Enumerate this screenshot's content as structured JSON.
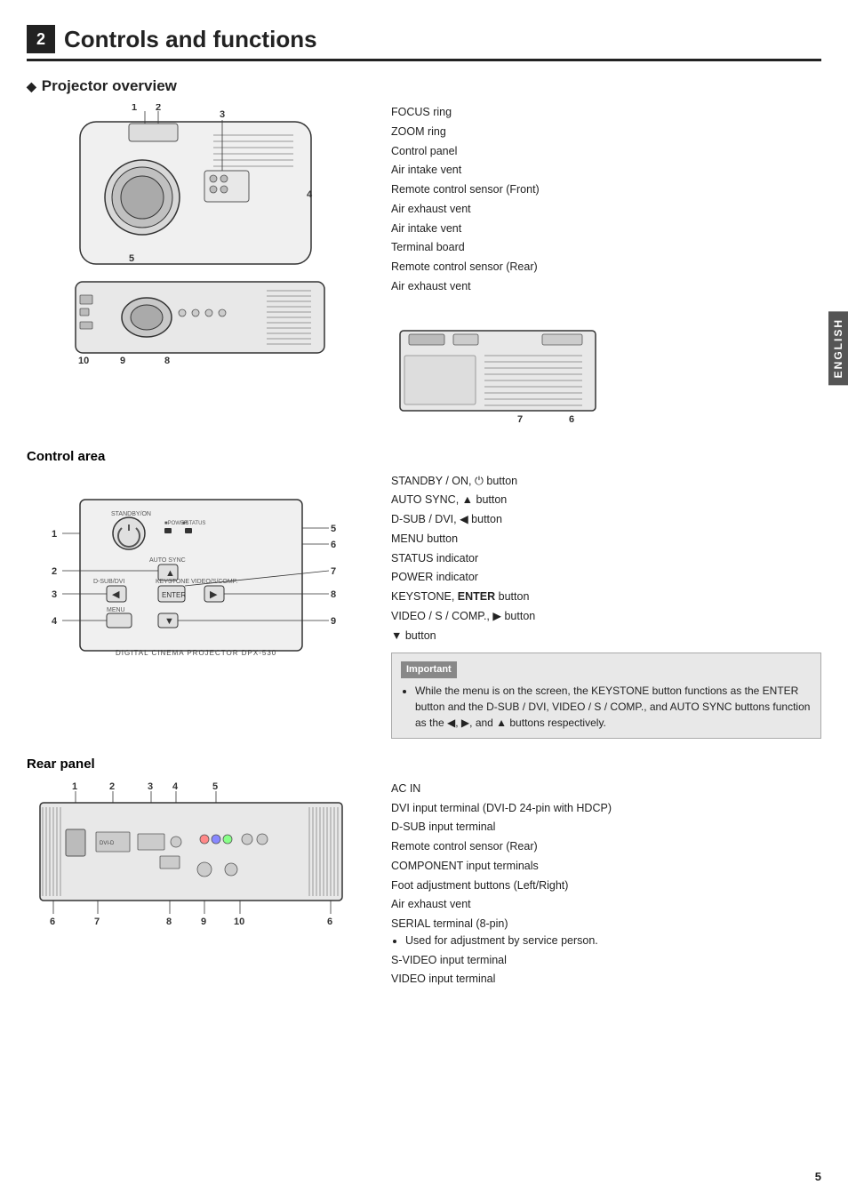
{
  "header": {
    "chapter": "2",
    "title": "Controls and functions"
  },
  "projector_overview": {
    "section_title": "Projector overview",
    "items": [
      "FOCUS ring",
      "ZOOM ring",
      "Control panel",
      "Air intake vent",
      "Remote control sensor (Front)",
      "Air exhaust vent",
      "Air intake vent",
      "Terminal board",
      "Remote control sensor (Rear)",
      "Air exhaust vent"
    ]
  },
  "control_area": {
    "section_title": "Control area",
    "items": [
      {
        "num": "1.",
        "text": "STANDBY / ON, "
      },
      {
        "num": "2.",
        "text": "AUTO SYNC, ▲ button"
      },
      {
        "num": "3.",
        "text": "D-SUB / DVI, ◀ button"
      },
      {
        "num": "4.",
        "text": "MENU button"
      },
      {
        "num": "5.",
        "text": "STATUS indicator"
      },
      {
        "num": "6.",
        "text": "POWER indicator"
      },
      {
        "num": "7.",
        "text": "KEYSTONE, ENTER button",
        "bold_part": "ENTER"
      },
      {
        "num": "8.",
        "text": "VIDEO / S / COMP., ▶ button"
      },
      {
        "num": "9.",
        "text": "▼ button"
      }
    ],
    "important_label": "Important",
    "important_text": "While the menu is on the screen, the KEYSTONE button functions as the ENTER button and the D-SUB / DVI, VIDEO / S / COMP., and AUTO SYNC buttons function as the ◀, ▶, and ▲ buttons respectively."
  },
  "rear_panel": {
    "section_title": "Rear panel",
    "items": [
      {
        "num": "1.",
        "text": "AC IN"
      },
      {
        "num": "2.",
        "text": "DVI input terminal (DVI-D 24-pin with HDCP)"
      },
      {
        "num": "3.",
        "text": "D-SUB input terminal"
      },
      {
        "num": "4.",
        "text": "Remote control sensor (Rear)"
      },
      {
        "num": "5.",
        "text": "COMPONENT input terminals"
      },
      {
        "num": "6.",
        "text": "Foot adjustment buttons (Left/Right)"
      },
      {
        "num": "7.",
        "text": "Air exhaust vent"
      },
      {
        "num": "8.",
        "text": "SERIAL terminal (8-pin)",
        "sub": "Used for adjustment by service person."
      },
      {
        "num": "9.",
        "text": "S-VIDEO input terminal"
      },
      {
        "num": "10.",
        "text": "VIDEO input terminal"
      }
    ]
  },
  "sidebar": {
    "label": "ENGLISH"
  },
  "page_number": "5"
}
